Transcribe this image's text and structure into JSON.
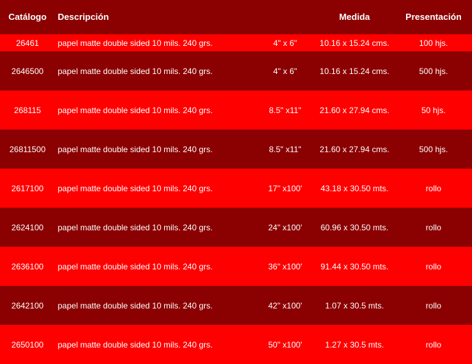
{
  "header": {
    "catalogo": "Catálogo",
    "descripcion": "Descripción",
    "medida": "Medida",
    "presentacion": "Presentación"
  },
  "colors": {
    "row_bright": "#ff0000",
    "row_dark": "#8b0000",
    "text": "#ffffff"
  },
  "rows": [
    {
      "catalogo": "26461",
      "descripcion": "papel matte double sided  10 mils. 240 grs.",
      "size": "4\" x 6\"",
      "medida": "10.16 x 15.24 cms.",
      "presentacion": "100 hjs."
    },
    {
      "catalogo": "2646500",
      "descripcion": "papel matte double sided  10 mils. 240 grs.",
      "size": "4\" x 6\"",
      "medida": "10.16 x 15.24 cms.",
      "presentacion": "500 hjs."
    },
    {
      "catalogo": "268115",
      "descripcion": "papel matte double sided  10 mils. 240 grs.",
      "size": "8.5\" x11\"",
      "medida": "21.60 x 27.94 cms.",
      "presentacion": "50 hjs."
    },
    {
      "catalogo": "26811500",
      "descripcion": "papel matte double sided  10 mils. 240 grs.",
      "size": "8.5\" x11\"",
      "medida": "21.60 x 27.94 cms.",
      "presentacion": "500 hjs."
    },
    {
      "catalogo": "2617100",
      "descripcion": "papel matte double sided  10 mils. 240 grs.",
      "size": "17\" x100'",
      "medida": "43.18 x 30.50 mts.",
      "presentacion": "rollo"
    },
    {
      "catalogo": "2624100",
      "descripcion": "papel matte double sided  10 mils. 240 grs.",
      "size": "24\" x100'",
      "medida": "60.96 x 30.50 mts.",
      "presentacion": "rollo"
    },
    {
      "catalogo": "2636100",
      "descripcion": "papel matte double sided  10 mils. 240 grs.",
      "size": "36\" x100'",
      "medida": "91.44 x 30.50 mts.",
      "presentacion": "rollo"
    },
    {
      "catalogo": "2642100",
      "descripcion": "papel matte double sided  10 mils. 240 grs.",
      "size": "42\" x100'",
      "medida": "1.07 x 30.5 mts.",
      "presentacion": "rollo"
    },
    {
      "catalogo": "2650100",
      "descripcion": "papel matte double sided  10 mils. 240 grs.",
      "size": "50\" x100'",
      "medida": "1.27 x 30.5 mts.",
      "presentacion": "rollo"
    }
  ]
}
